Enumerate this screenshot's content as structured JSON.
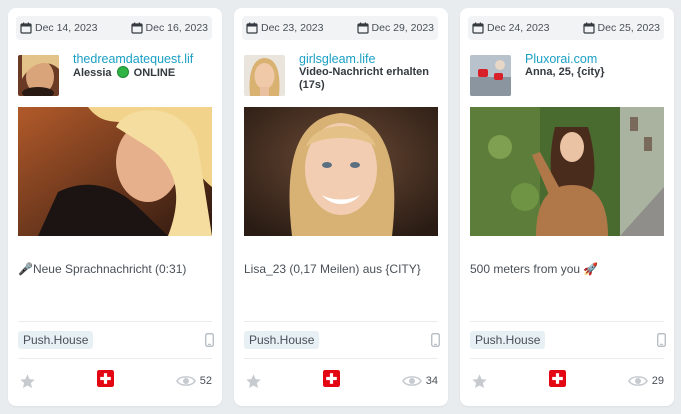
{
  "cards": [
    {
      "start_date": "Dec 14, 2023",
      "end_date": "Dec 16, 2023",
      "site": "thedreamdatequest.lif",
      "subtitle_name": "Alessia",
      "subtitle_status": "ONLINE",
      "message": "🎤Neue Sprachnachricht (0:31)",
      "network": "Push.House",
      "views": "52"
    },
    {
      "start_date": "Dec 23, 2023",
      "end_date": "Dec 29, 2023",
      "site": "girlsgleam.life",
      "subtitle": "Video-Nachricht erhalten (17s)",
      "message": "Lisa_23 (0,17 Meilen) aus {CITY}",
      "network": "Push.House",
      "views": "34"
    },
    {
      "start_date": "Dec 24, 2023",
      "end_date": "Dec 25, 2023",
      "site": "Pluxorai.com",
      "subtitle": "Anna, 25, {city}",
      "message": "500 meters from you 🚀",
      "network": "Push.House",
      "views": "29"
    }
  ],
  "icons": {
    "date": "calendar-icon",
    "device": "mobile-phone-icon",
    "favorite": "star-icon",
    "country": "swiss-flag-icon",
    "views": "eye-icon"
  },
  "colors": {
    "site_link": "#1a9fc4",
    "badge_bg": "#e7f1f5",
    "online": "#2fb344",
    "flag": "#e30613"
  }
}
